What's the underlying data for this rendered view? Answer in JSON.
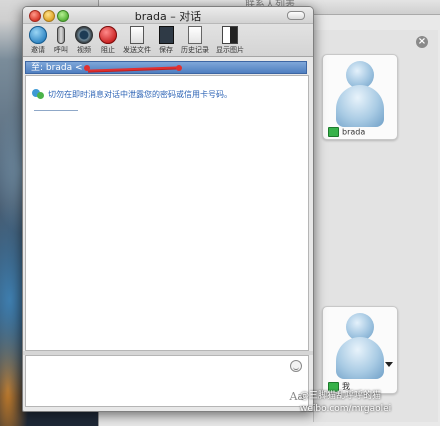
{
  "contacts_window": {
    "title": "联系人列表"
  },
  "chat_window": {
    "title": "brada – 对话",
    "toolbar": [
      {
        "id": "invite",
        "label": "邀请",
        "icon": "globe-icon"
      },
      {
        "id": "call",
        "label": "呼叫",
        "icon": "microphone-icon"
      },
      {
        "id": "video",
        "label": "视频",
        "icon": "webcam-icon"
      },
      {
        "id": "block",
        "label": "阻止",
        "icon": "block-icon"
      },
      {
        "id": "send_file",
        "label": "发送文件",
        "icon": "file-icon"
      },
      {
        "id": "save",
        "label": "保存",
        "icon": "save-icon"
      },
      {
        "id": "history",
        "label": "历史记录",
        "icon": "history-icon"
      },
      {
        "id": "show_picture",
        "label": "显示图片",
        "icon": "picture-icon"
      }
    ],
    "recipient": {
      "prefix": "至:",
      "name": "brada",
      "address_hint": "<"
    },
    "warning": "切勿在即时消息对话中泄露您的密码或信用卡号码。",
    "compose": {
      "font_button": "Aa",
      "emoticon_icon": "smiley-icon"
    }
  },
  "side_panel": {
    "remote_contact": {
      "name": "brada",
      "status": "online"
    },
    "self_contact": {
      "name": "我",
      "status": "online"
    }
  },
  "watermark": {
    "line1": "@三脚猫乱呼呼的猫",
    "line2": "weibo.com/mrgaolei"
  },
  "colors": {
    "accent": "#4f7fc0",
    "online": "#37b24a",
    "warning_text": "#2c63b5"
  }
}
